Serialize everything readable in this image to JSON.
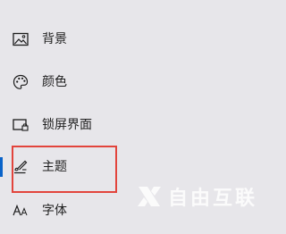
{
  "nav": {
    "items": [
      {
        "label": "背景",
        "icon": "picture-icon"
      },
      {
        "label": "颜色",
        "icon": "palette-icon"
      },
      {
        "label": "锁屏界面",
        "icon": "lock-screen-icon"
      },
      {
        "label": "主题",
        "icon": "theme-brush-icon",
        "active": true
      },
      {
        "label": "字体",
        "icon": "font-icon"
      }
    ]
  },
  "watermark": {
    "text": "自由互联"
  },
  "colors": {
    "background": "#e7e6ea",
    "accent": "#0a63c9",
    "highlight": "#e2443c"
  }
}
